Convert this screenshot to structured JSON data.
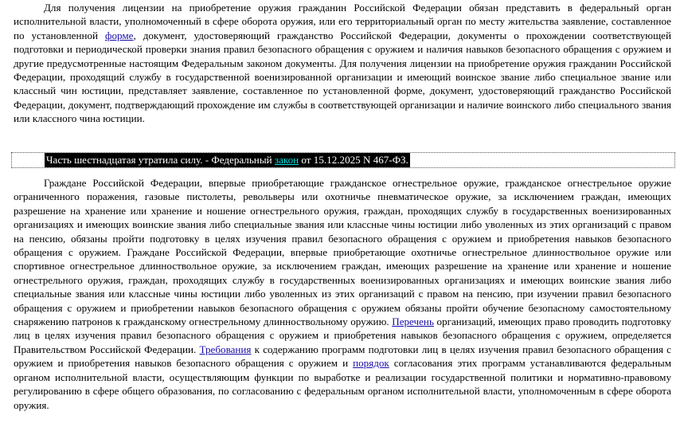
{
  "doc": {
    "p1": {
      "t1": "Для получения лицензии на приобретение оружия гражданин Российской Федерации обязан представить в федеральный орган исполнительной власти, уполномоченный в сфере оборота оружия, или его территориальный орган по месту жительства заявление, составленное по установленной ",
      "link1": "форме",
      "t2": ", документ, удостоверяющий гражданство Российской Федерации, документы о прохождении соответствующей подготовки и периодической проверки знания правил безопасного обращения с оружием и наличия навыков безопасного обращения с оружием и другие предусмотренные настоящим Федеральным законом документы. Для получения лицензии на приобретение оружия гражданин Российской Федерации, проходящий службу в государственной военизированной организации и имеющий воинское звание либо специальное звание или классный чин юстиции, представляет заявление, составленное по установленной форме, документ, удостоверяющий гражданство Российской Федерации, документ, подтверждающий прохождение им службы в соответствующей организации и наличие воинского либо специального звания или классного чина юстиции."
    },
    "lost": {
      "t1": "Часть шестнадцатая утратила силу. - Федеральный ",
      "link": "закон",
      "t2": " от 15.12.2025 N 467-ФЗ."
    },
    "p3": {
      "t1": "Граждане Российской Федерации, впервые приобретающие гражданское огнестрельное оружие, гражданское огнестрельное оружие ограниченного поражения, газовые пистолеты, револьверы или охотничье пневматическое оружие, за исключением граждан, имеющих разрешение на хранение или хранение и ношение огнестрельного оружия, граждан, проходящих службу в государственных военизированных организациях и имеющих воинские звания либо специальные звания или классные чины юстиции либо уволенных из этих организаций с правом на пенсию, обязаны пройти подготовку в целях изучения правил безопасного обращения с оружием и приобретения навыков безопасного обращения с оружием. Граждане Российской Федерации, впервые приобретающие охотничье огнестрельное длинноствольное оружие или спортивное огнестрельное длинноствольное оружие, за исключением граждан, имеющих разрешение на хранение или хранение и ношение огнестрельного оружия, граждан, проходящих службу в государственных военизированных организациях и имеющих воинские звания либо специальные звания или классные чины юстиции либо уволенных из этих организаций с правом на пенсию, при изучении правил безопасного обращения с оружием и приобретении навыков безопасного обращения с оружием обязаны пройти обучение безопасному самостоятельному снаряжению патронов к гражданскому огнестрельному длинноствольному оружию. ",
      "link1": "Перечень",
      "t2": " организаций, имеющих право проводить подготовку лиц в целях изучения правил безопасного обращения с оружием и приобретения навыков безопасного обращения с оружием, определяется Правительством Российской Федерации. ",
      "link2": "Требования",
      "t3": " к содержанию программ подготовки лиц в целях изучения правил безопасного обращения с оружием и приобретения навыков безопасного обращения с оружием и ",
      "link3": "порядок",
      "t4": " согласования этих программ устанавливаются федеральным органом исполнительной власти, осуществляющим функции по выработке и реализации государственной политики и нормативно-правовому регулированию в сфере общего образования, по согласованию с федеральным органом исполнительной власти, уполномоченным в сфере оборота оружия."
    },
    "colors": {
      "link": "#1a0dab",
      "highlight_bg": "#000000",
      "highlight_text": "#ffffff",
      "highlight_link": "#00e0e0"
    }
  }
}
